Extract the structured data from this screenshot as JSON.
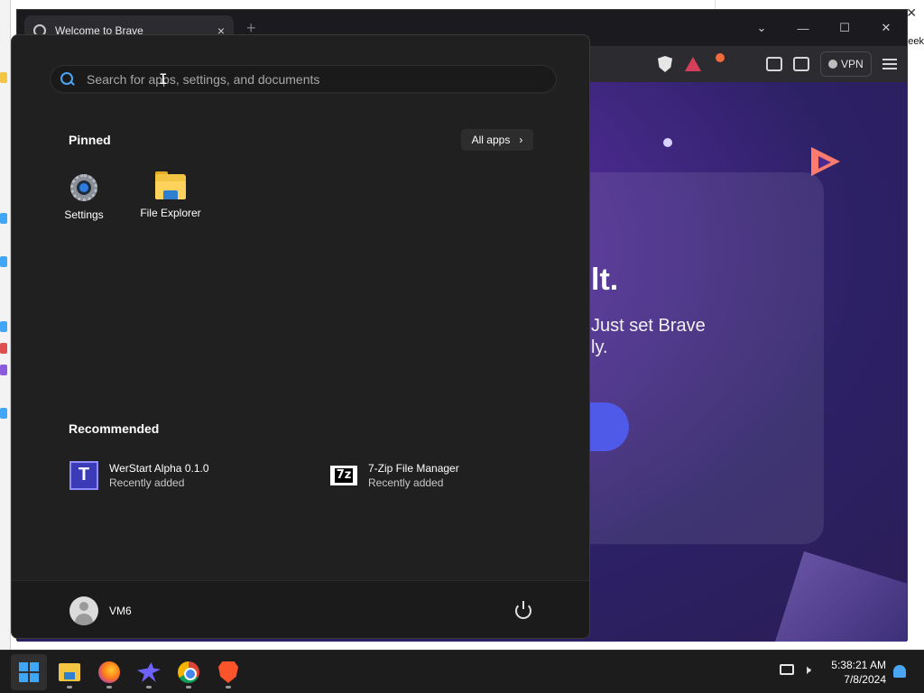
{
  "browser": {
    "tab_title": "Welcome to Brave",
    "new_tab": "+",
    "tab_close": "×",
    "controls": {
      "minimize": "—",
      "maximize": "☐",
      "close": "✕",
      "dropdown": "⌄"
    },
    "vpn_label": "VPN",
    "welcome": {
      "heading": "lt.",
      "subtitle_line1": "Just set Brave",
      "subtitle_line2": "ly."
    }
  },
  "background_window": {
    "close": "✕",
    "peek_text": "eek"
  },
  "start_menu": {
    "search_placeholder": "Search for apps, settings, and documents",
    "pinned_title": "Pinned",
    "all_apps_label": "All apps",
    "all_apps_chevron": "›",
    "pinned_apps": [
      {
        "label": "Settings",
        "icon": "settings-icon"
      },
      {
        "label": "File Explorer",
        "icon": "folder-icon"
      }
    ],
    "recommended_title": "Recommended",
    "recommended": [
      {
        "name": "WerStart Alpha 0.1.0",
        "sub": "Recently added",
        "icon": "werstart-icon",
        "icon_text": "T"
      },
      {
        "name": "7-Zip File Manager",
        "sub": "Recently added",
        "icon": "7zip-icon",
        "icon_text": "7z"
      }
    ],
    "user_name": "VM6"
  },
  "taskbar": {
    "apps": [
      {
        "name": "start",
        "icon": "windows-logo-icon"
      },
      {
        "name": "file-explorer",
        "icon": "folder-icon"
      },
      {
        "name": "firefox",
        "icon": "firefox-icon"
      },
      {
        "name": "bird-app",
        "icon": "bird-icon"
      },
      {
        "name": "chrome",
        "icon": "chrome-icon"
      },
      {
        "name": "brave",
        "icon": "brave-icon"
      }
    ],
    "clock_time": "5:38:21 AM",
    "clock_date": "7/8/2024"
  },
  "colors": {
    "accent": "#4aa6f5",
    "start_bg": "#202020",
    "brave_orange": "#fb542b",
    "welcome_purple": "#4b2a8f"
  }
}
